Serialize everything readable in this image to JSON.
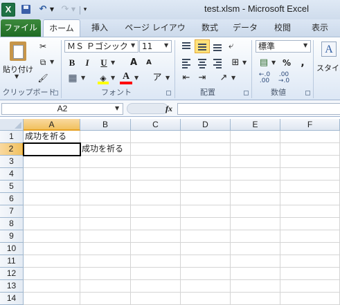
{
  "titlebar": {
    "app_icon": "excel-icon",
    "app_icon_letter": "X",
    "undo_glyph": "↶",
    "redo_glyph": "↷",
    "title": "test.xlsm  -  Microsoft Excel"
  },
  "tabs": {
    "file": "ファイル",
    "home": "ホーム",
    "insert": "挿入",
    "page_layout": "ページ レイアウト",
    "formulas": "数式",
    "data": "データ",
    "review": "校閲",
    "view": "表示"
  },
  "ribbon": {
    "clipboard": {
      "label": "クリップボード",
      "paste": "貼り付け"
    },
    "font": {
      "label": "フォント",
      "name": "ＭＳ Ｐゴシック",
      "size": "11",
      "bold": "B",
      "italic": "I",
      "underline": "U",
      "grow": "A",
      "shrink": "A",
      "font_color_glyph": "A",
      "phonetic_glyph": "ア",
      "fill_color": "#ffff00",
      "font_color": "#ff0000"
    },
    "alignment": {
      "label": "配置"
    },
    "number": {
      "label": "数値",
      "format": "標準",
      "percent": "%",
      "comma": ",",
      "dec_inc": "←.0\n.00",
      "dec_dec": ".00\n→.0"
    },
    "styles": {
      "label": "スタイル",
      "icon_glyph": "A"
    }
  },
  "formula_bar": {
    "name_box": "A2",
    "fx": "fx",
    "value": ""
  },
  "grid": {
    "columns": [
      "A",
      "B",
      "C",
      "D",
      "E",
      "F"
    ],
    "rows": [
      "1",
      "2",
      "3",
      "4",
      "5",
      "6",
      "7",
      "8",
      "9",
      "10",
      "11",
      "12",
      "13",
      "14"
    ],
    "selected_cell": "A2",
    "cells": {
      "A1": "成功を祈る",
      "B2": "成功を祈る"
    }
  }
}
